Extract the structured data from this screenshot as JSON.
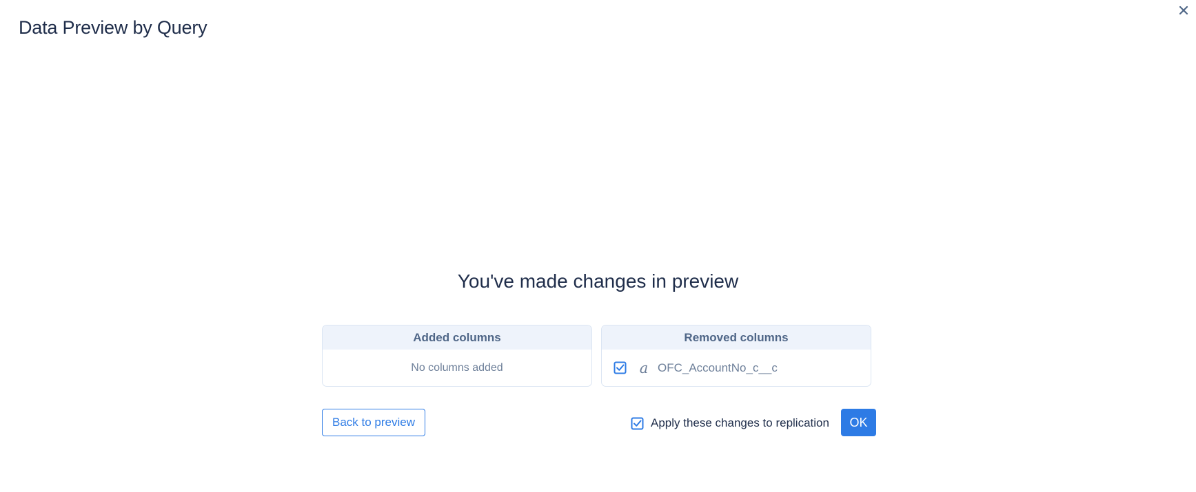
{
  "dialog": {
    "title": "Data Preview by Query",
    "close_icon": "close-icon"
  },
  "summary": {
    "heading": "You've made changes in preview",
    "added": {
      "header": "Added columns",
      "empty_text": "No columns added"
    },
    "removed": {
      "header": "Removed columns",
      "columns": [
        {
          "name": "OFC_AccountNo_c__c",
          "type_icon": "string-type-icon",
          "type_glyph": "a",
          "checked": true
        }
      ]
    }
  },
  "actions": {
    "back_label": "Back to preview",
    "apply_label": "Apply these changes to replication",
    "apply_checked": true,
    "ok_label": "OK"
  },
  "colors": {
    "accent": "#2d7be5",
    "text": "#1f2d4a",
    "muted": "#6d7f99",
    "panel_header_bg": "#eef3fb"
  }
}
